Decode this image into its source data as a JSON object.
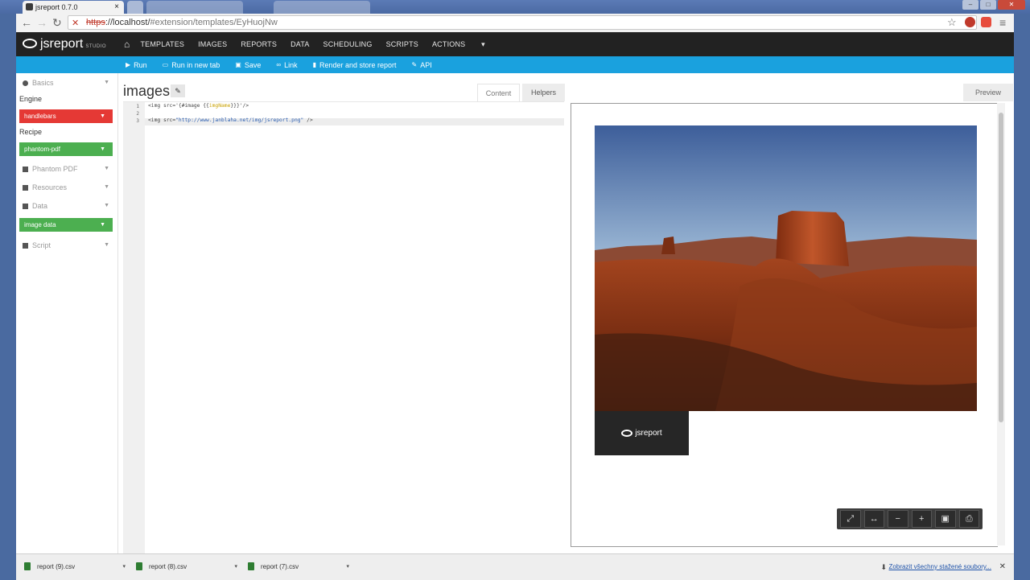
{
  "browser": {
    "tabs": [
      {
        "title": "jsreport 0.7.0",
        "active": true
      },
      {
        "title": "",
        "active": false
      },
      {
        "title": "",
        "active": false
      },
      {
        "title": "",
        "active": false
      }
    ],
    "url_protocol": "https",
    "url_host": "://localhost/",
    "url_path": "#extension/templates/EyHuojNw"
  },
  "app": {
    "logo_text": "jsreport",
    "logo_sub": "STUDIO",
    "nav": [
      "TEMPLATES",
      "IMAGES",
      "REPORTS",
      "DATA",
      "SCHEDULING",
      "SCRIPTS",
      "ACTIONS"
    ],
    "toolbar": [
      "Run",
      "Run in new tab",
      "Save",
      "Link",
      "Render and store report",
      "API"
    ]
  },
  "sidebar": {
    "basics": "Basics",
    "engine_label": "Engine",
    "engine_value": "handlebars",
    "recipe_label": "Recipe",
    "recipe_value": "phantom-pdf",
    "phantom": "Phantom PDF",
    "resources": "Resources",
    "data": "Data",
    "data_value": "image data",
    "script": "Script"
  },
  "editor": {
    "title": "images",
    "tab_content": "Content",
    "tab_helpers": "Helpers",
    "line_numbers": [
      "1",
      "2",
      "3"
    ],
    "line1_a": "<img src='{#image {{",
    "line1_b": "imgName",
    "line1_c": "}}}'/>",
    "line3_a": "<img src=",
    "line3_b": "\"http://www.janblaha.net/img/jsreport.png\"",
    "line3_c": " />"
  },
  "preview": {
    "tab": "Preview",
    "logo_text": "jsreport"
  },
  "downloads": {
    "files": [
      "report (9).csv",
      "report (8).csv",
      "report (7).csv"
    ],
    "show_all": "Zobrazit všechny stažené soubory..."
  },
  "colors": {
    "navbar": "#222222",
    "toolbar": "#1aa1de",
    "engine": "#e53935",
    "recipe": "#4caf50"
  }
}
